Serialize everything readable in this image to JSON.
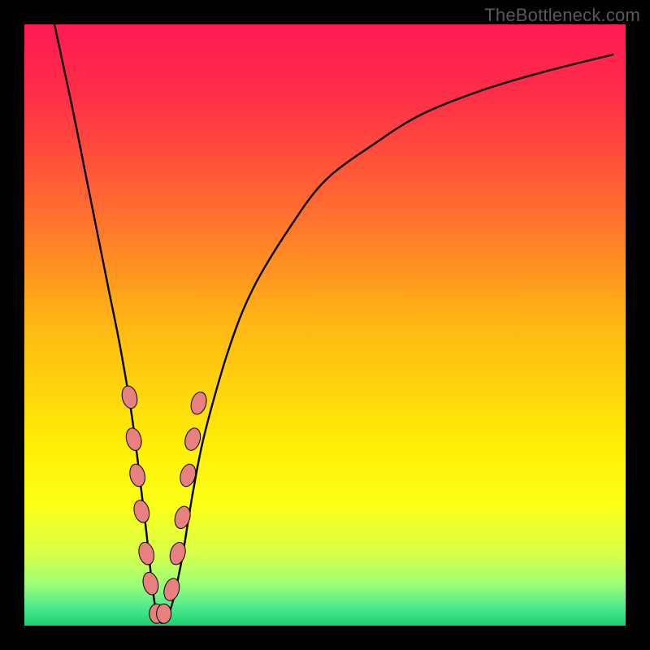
{
  "watermark": "TheBottleneck.com",
  "colors": {
    "frame": "#000000",
    "curve": "#000000",
    "bead_fill": "#e98080",
    "bead_stroke": "#000000",
    "gradient_stops": [
      {
        "offset": 0.0,
        "color": "#ff1a52"
      },
      {
        "offset": 0.12,
        "color": "#ff2f47"
      },
      {
        "offset": 0.3,
        "color": "#ff6a30"
      },
      {
        "offset": 0.5,
        "color": "#ffb714"
      },
      {
        "offset": 0.7,
        "color": "#ffee06"
      },
      {
        "offset": 0.8,
        "color": "#fbff16"
      },
      {
        "offset": 0.88,
        "color": "#d9ff4a"
      },
      {
        "offset": 0.93,
        "color": "#9eff77"
      },
      {
        "offset": 0.97,
        "color": "#4fe98d"
      },
      {
        "offset": 1.0,
        "color": "#18d070"
      }
    ]
  },
  "chart_data": {
    "type": "line",
    "title": "",
    "xlabel": "",
    "ylabel": "",
    "xlim": [
      0,
      100
    ],
    "ylim": [
      0,
      100
    ],
    "note": "Single V-shaped curve plotted over a vertical spectral gradient (red→yellow→green). Minimum of the curve sits near x≈22, y≈0. Salmon-colored rounded beads are placed along both arms of the V near the bottom. Values below are visual estimates read from the figure; no axes, ticks, or labels are rendered.",
    "series": [
      {
        "name": "v-curve",
        "x": [
          5,
          8,
          10,
          12,
          14,
          16,
          18,
          20,
          22,
          24,
          26,
          28,
          30,
          34,
          38,
          44,
          50,
          58,
          66,
          76,
          86,
          98
        ],
        "y": [
          100,
          86,
          76,
          66,
          56,
          46,
          34,
          18,
          2,
          2,
          10,
          22,
          32,
          46,
          56,
          66,
          74,
          80,
          85,
          89,
          92,
          95
        ]
      }
    ],
    "beads": [
      {
        "arm": "left",
        "x": 17.5,
        "y": 38
      },
      {
        "arm": "left",
        "x": 18.2,
        "y": 31
      },
      {
        "arm": "left",
        "x": 18.8,
        "y": 25
      },
      {
        "arm": "left",
        "x": 19.5,
        "y": 19
      },
      {
        "arm": "left",
        "x": 20.3,
        "y": 12
      },
      {
        "arm": "left",
        "x": 21.0,
        "y": 7
      },
      {
        "arm": "bottom",
        "x": 22.0,
        "y": 2
      },
      {
        "arm": "bottom",
        "x": 23.2,
        "y": 2
      },
      {
        "arm": "right",
        "x": 24.5,
        "y": 6
      },
      {
        "arm": "right",
        "x": 25.5,
        "y": 12
      },
      {
        "arm": "right",
        "x": 26.3,
        "y": 18
      },
      {
        "arm": "right",
        "x": 27.2,
        "y": 25
      },
      {
        "arm": "right",
        "x": 28.0,
        "y": 31
      },
      {
        "arm": "right",
        "x": 29.0,
        "y": 37
      }
    ]
  }
}
